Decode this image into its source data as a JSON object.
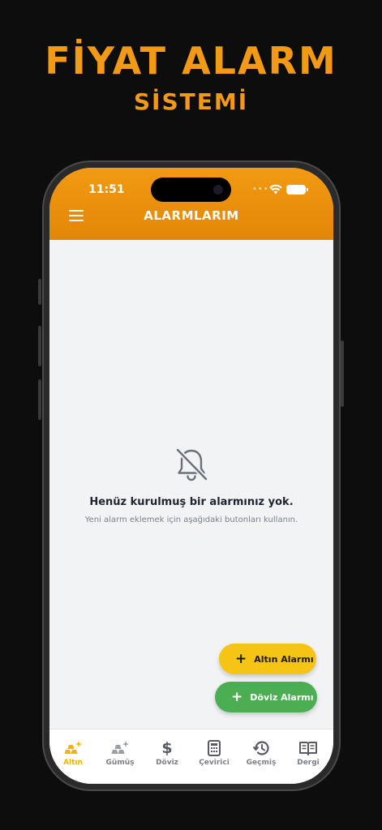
{
  "headline": {
    "line1": "FİYAT ALARM",
    "line2": "SİSTEMİ"
  },
  "status_bar": {
    "time": "11:51",
    "dots": "••••"
  },
  "app_bar": {
    "title": "ALARMLARIM"
  },
  "empty_state": {
    "title": "Henüz kurulmuş bir alarmınız yok.",
    "subtitle": "Yeni alarm eklemek için aşağıdaki butonları kullanın."
  },
  "actions": {
    "gold_alarm": {
      "plus": "+",
      "label": "Altın Alarmı",
      "color": "#f5c414"
    },
    "fx_alarm": {
      "plus": "+",
      "label": "Döviz Alarmı",
      "color": "#4cae53"
    }
  },
  "tabs": [
    {
      "label": "Altın",
      "icon": "gold-bars-icon",
      "active": true
    },
    {
      "label": "Gümüş",
      "icon": "silver-bars-icon",
      "active": false
    },
    {
      "label": "Döviz",
      "icon": "dollar-icon",
      "active": false
    },
    {
      "label": "Çevirici",
      "icon": "calculator-icon",
      "active": false
    },
    {
      "label": "Geçmiş",
      "icon": "history-icon",
      "active": false
    },
    {
      "label": "Dergi",
      "icon": "book-icon",
      "active": false
    }
  ],
  "colors": {
    "accent": "#f29a16",
    "active_tab": "#f5b400",
    "background": "#0d0d0d"
  }
}
